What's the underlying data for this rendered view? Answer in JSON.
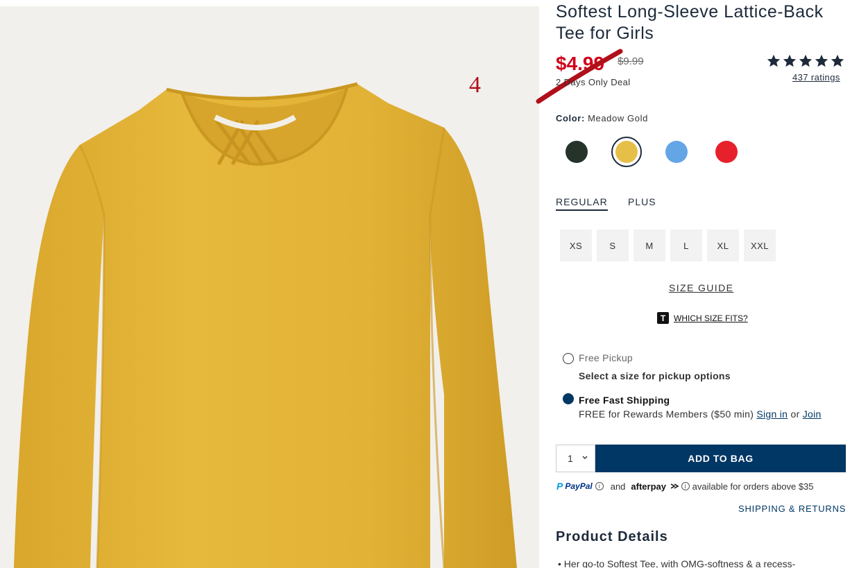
{
  "annotation": {
    "number": "4"
  },
  "product": {
    "title": "Softest Long-Sleeve Lattice-Back Tee for Girls",
    "price_sale": "$4.99",
    "price_original": "$9.99",
    "deal_text": "2 Days Only Deal",
    "rating_stars": 5,
    "rating_count": "437 ratings"
  },
  "color": {
    "label": "Color:",
    "selected": "Meadow Gold",
    "swatches": [
      {
        "name": "dark-green",
        "hex": "#25332a"
      },
      {
        "name": "meadow-gold",
        "hex": "#e6bf48"
      },
      {
        "name": "sky-blue",
        "hex": "#64a5e6"
      },
      {
        "name": "red",
        "hex": "#e6212b"
      }
    ]
  },
  "fit": {
    "tabs": [
      "REGULAR",
      "PLUS"
    ],
    "active": "REGULAR"
  },
  "sizes": [
    "XS",
    "S",
    "M",
    "L",
    "XL",
    "XXL"
  ],
  "links": {
    "size_guide": "SIZE GUIDE",
    "which_size_badge": "T",
    "which_size": "WHICH SIZE FITS?",
    "shipping_returns": "SHIPPING & RETURNS"
  },
  "fulfillment": {
    "pickup_label": "Free Pickup",
    "pickup_note": "Select a size for pickup options",
    "shipping_label": "Free Fast Shipping",
    "shipping_note_prefix": "FREE for Rewards Members ($50 min)",
    "sign_in": "Sign in",
    "or": "or",
    "join": "Join"
  },
  "cart": {
    "quantity": "1",
    "add_to_bag": "ADD TO BAG"
  },
  "payments": {
    "paypal": "PayPal",
    "and": "and",
    "afterpay": "afterpay",
    "note": "available for orders above $35"
  },
  "details": {
    "title": "Product Details",
    "bullet": "Her go-to Softest Tee, with OMG-softness & a recess-"
  },
  "colors": {
    "brand_navy": "#003764",
    "sale_red": "#d0021b",
    "shirt_gold": "#e3b234",
    "annotation_red": "#b0101a"
  }
}
